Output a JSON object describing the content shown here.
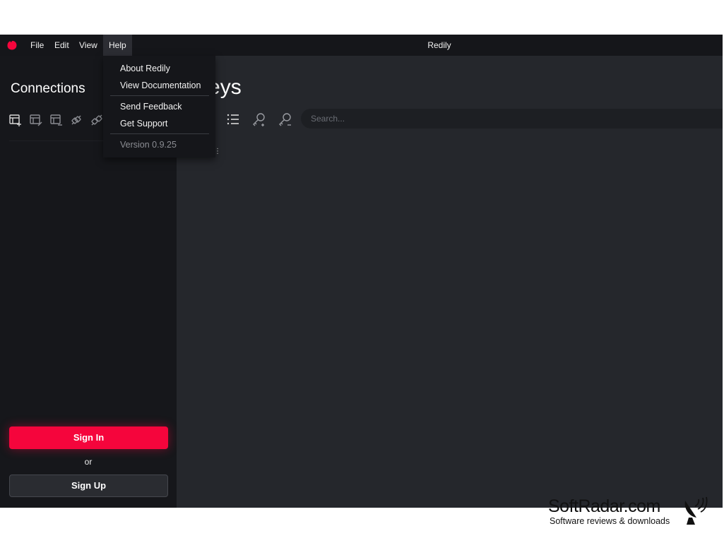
{
  "titlebar": {
    "menus": [
      "File",
      "Edit",
      "View",
      "Help"
    ],
    "title": "Redily"
  },
  "sidebar": {
    "title": "Connections",
    "tools": [
      "add-connection-icon",
      "edit-connection-icon",
      "remove-connection-icon",
      "connect-icon",
      "disconnect-icon"
    ],
    "sign_in": "Sign In",
    "or": "or",
    "sign_up": "Sign Up"
  },
  "main": {
    "title": "Keys",
    "tools": [
      "list-icon",
      "add-key-icon",
      "remove-key-icon"
    ],
    "search_placeholder": "Search...",
    "partial_text": "⋮"
  },
  "help_menu": {
    "items": [
      "About Redily",
      "View Documentation",
      "Send Feedback",
      "Get Support"
    ],
    "version": "Version 0.9.25"
  },
  "watermark": {
    "name": "SoftRadar.com",
    "tagline": "Software reviews & downloads"
  },
  "colors": {
    "accent": "#f5053c",
    "sidebar_bg": "#16171b",
    "main_bg": "#25272c"
  }
}
